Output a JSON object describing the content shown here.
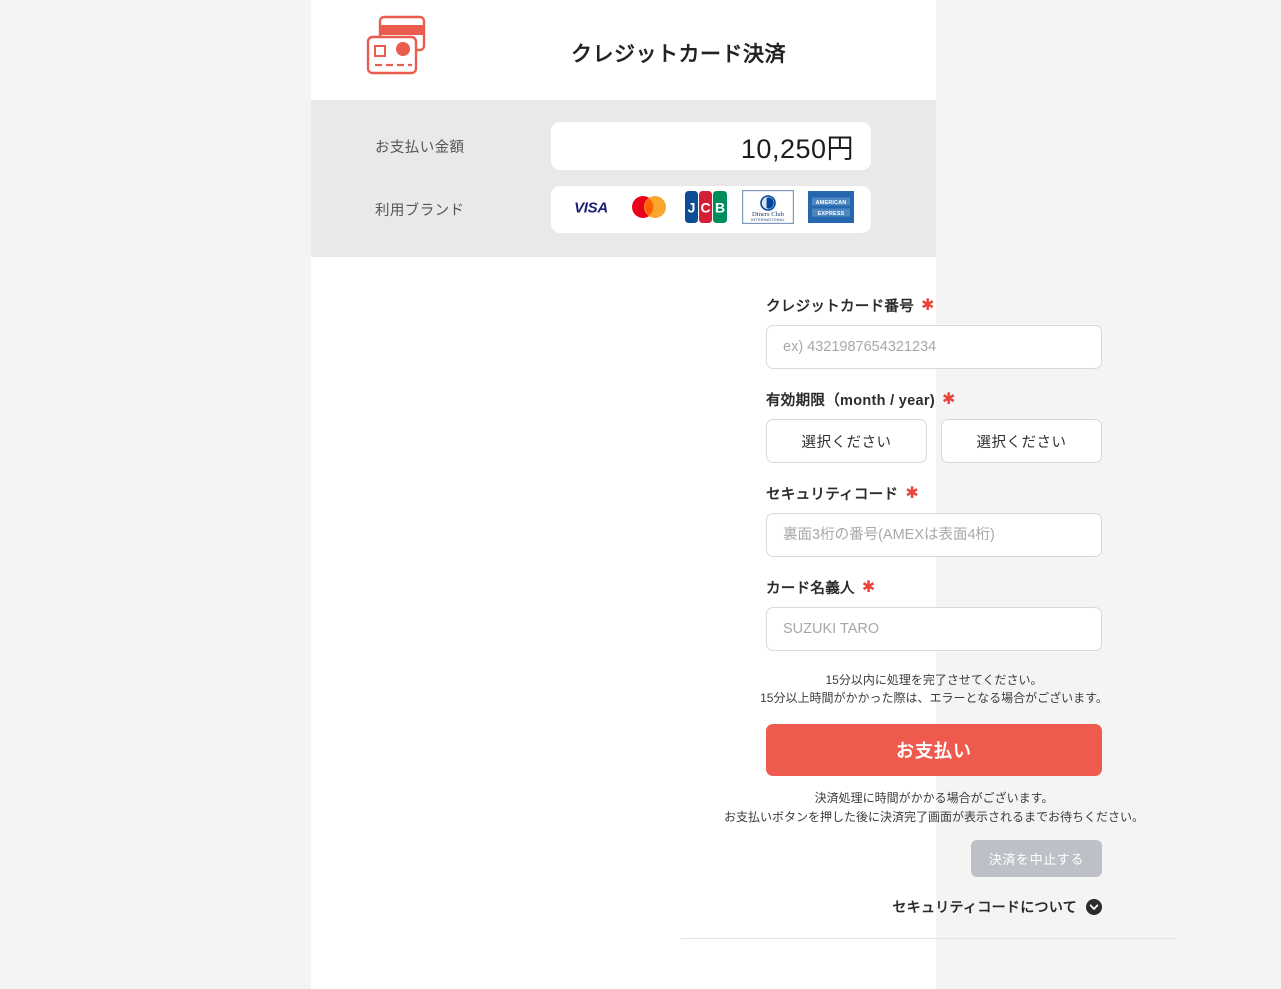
{
  "header": {
    "title": "クレジットカード決済",
    "icon": "credit-cards-icon"
  },
  "summary": {
    "amount_label": "お支払い金額",
    "amount_value": "10,250円",
    "brands_label": "利用ブランド",
    "brands": [
      {
        "name": "visa",
        "text": "VISA"
      },
      {
        "name": "mastercard",
        "text": ""
      },
      {
        "name": "jcb",
        "text": "JCB"
      },
      {
        "name": "diners-club",
        "text": "Diners Club",
        "subtext": "INTERNATIONAL"
      },
      {
        "name": "american-express",
        "text": "AMERICAN EXPRESS"
      }
    ]
  },
  "form": {
    "card_number": {
      "label": "クレジットカード番号",
      "required_mark": "✱",
      "placeholder": "ex) 4321987654321234",
      "value": ""
    },
    "expiry": {
      "label": "有効期限（month / year)",
      "required_mark": "✱",
      "month_selected": "選択ください",
      "year_selected": "選択ください"
    },
    "security_code": {
      "label": "セキュリティコード",
      "required_mark": "✱",
      "placeholder": "裏面3桁の番号(AMEXは表面4桁)",
      "value": ""
    },
    "card_holder": {
      "label": "カード名義人",
      "required_mark": "✱",
      "placeholder": "SUZUKI TARO",
      "value": ""
    },
    "notice_time_line1": "15分以内に処理を完了させてください。",
    "notice_time_line2": "15分以上時間がかかった際は、エラーとなる場合がございます。",
    "pay_button": "お支払い",
    "notice_processing_line1": "決済処理に時間がかかる場合がございます。",
    "notice_processing_line2": "お支払いボタンを押した後に決済完了画面が表示されるまでお待ちください。",
    "cancel_button": "決済を中止する",
    "security_info_link": "セキュリティコードについて"
  },
  "colors": {
    "accent": "#ee5b4e",
    "required": "#e8453c",
    "band_bg": "#e9e9e9",
    "page_bg": "#f4f4f4",
    "cancel_bg": "#bdc0c6"
  }
}
